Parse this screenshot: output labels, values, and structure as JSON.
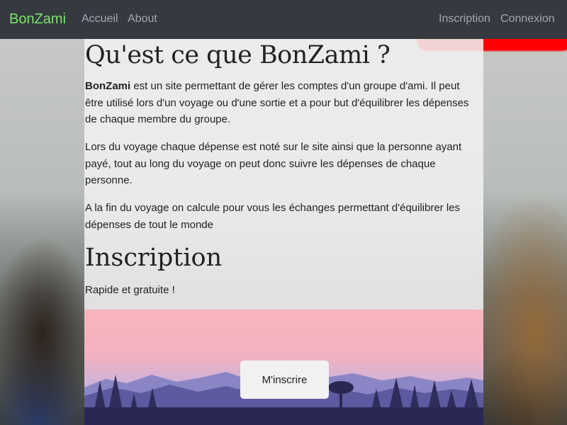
{
  "navbar": {
    "brand": "BonZami",
    "links": [
      "Accueil",
      "About"
    ],
    "right_links": [
      "Inscription",
      "Connexion"
    ],
    "brand_color": "#7ee36c",
    "background": "#343a40"
  },
  "about": {
    "title": "Qu'est ce que BonZami ?",
    "p1_strong": "BonZami",
    "p1_rest": " est un site permettant de gérer les comptes d'un groupe d'ami. Il peut être utilisé lors d'un voyage ou d'une sortie et a pour but d'équilibrer les dépenses de chaque membre du groupe.",
    "p2": "Lors du voyage chaque dépense est noté sur le site ainsi que la personne ayant payé, tout au long du voyage on peut donc suivre les dépenses de chaque personne.",
    "p3": "A la fin du voyage on calcule pour vous les échanges permettant d'équilibrer les dépenses de tout le monde"
  },
  "signup": {
    "title": "Inscription",
    "tagline": "Rapide et gratuite !",
    "button": "M'inscrire"
  }
}
